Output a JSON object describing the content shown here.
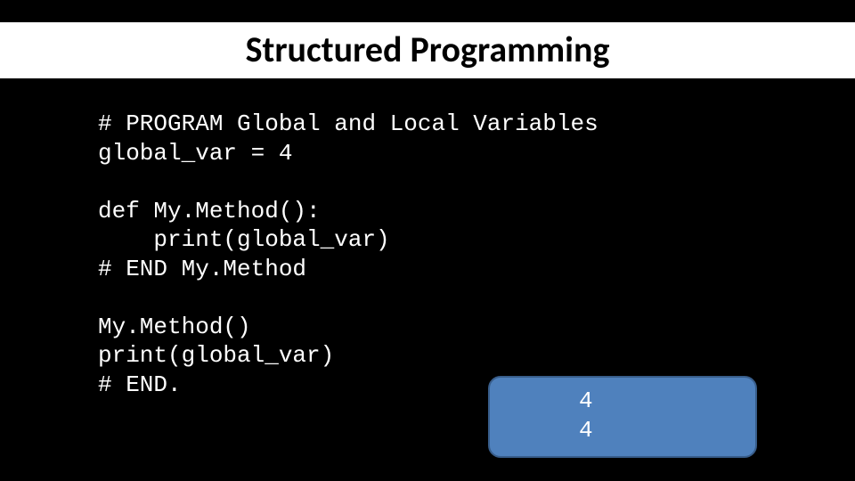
{
  "slide": {
    "title": "Structured Programming"
  },
  "code": {
    "line1": "# PROGRAM Global and Local Variables",
    "line2": "global_var = 4",
    "line3": "",
    "line4": "def My.Method():",
    "line5": "    print(global_var)",
    "line6": "# END My.Method",
    "line7": "",
    "line8": "My.Method()",
    "line9": "print(global_var)",
    "line10": "# END."
  },
  "output": {
    "line1": "4",
    "line2": "4"
  }
}
